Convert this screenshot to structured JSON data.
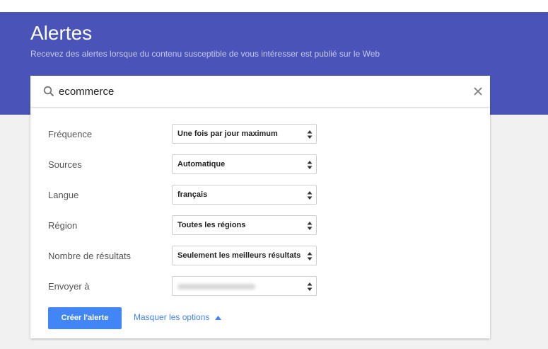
{
  "header": {
    "title": "Alertes",
    "subtitle": "Recevez des alertes lorsque du contenu susceptible de vous intéresser est publié sur le Web"
  },
  "search": {
    "value": "ecommerce",
    "icon": "search-icon",
    "clear_icon": "close-icon"
  },
  "options": [
    {
      "label": "Fréquence",
      "value": "Une fois par jour maximum"
    },
    {
      "label": "Sources",
      "value": "Automatique"
    },
    {
      "label": "Langue",
      "value": "français"
    },
    {
      "label": "Région",
      "value": "Toutes les régions"
    },
    {
      "label": "Nombre de résultats",
      "value": "Seulement les meilleurs résultats"
    },
    {
      "label": "Envoyer à",
      "value": ""
    }
  ],
  "actions": {
    "create_label": "Créer l'alerte",
    "toggle_options_label": "Masquer les options"
  },
  "colors": {
    "header": "#4a54b8",
    "primary": "#4285f4"
  }
}
